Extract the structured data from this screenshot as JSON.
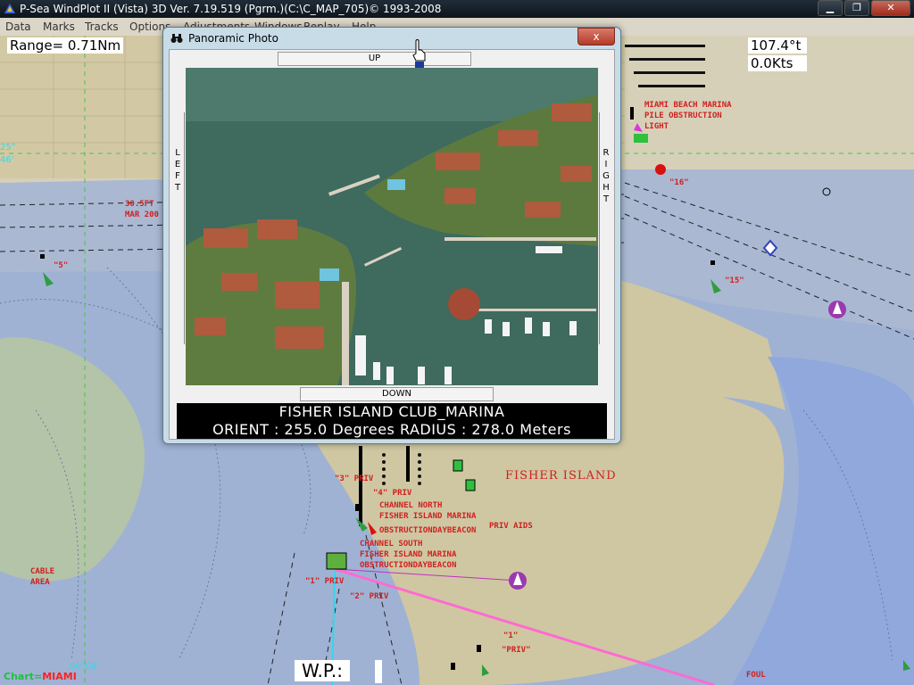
{
  "window": {
    "title": "P-Sea WindPlot II (Vista)  3D Ver. 7.19.519 (Pgrm.)(C:\\C_MAP_705)© 1993-2008",
    "minimize": "▁",
    "maximize": "❐",
    "close": "✕"
  },
  "menu": [
    "Data",
    "Marks",
    "Tracks",
    "Options",
    "Adjustments",
    "Windows",
    "Replay",
    "Help"
  ],
  "map": {
    "range_label": "Range=",
    "range_value": "0.71Nm",
    "heading": "107.4°t",
    "speed": "0.0Kts",
    "waypoint_label": "W.P.:",
    "chart_label": "Chart=",
    "chart_value": "MIAMI",
    "coord_top": "25°",
    "coord_top2": "46'",
    "coord_bottom": "80°08'",
    "labels": {
      "fisher_island": "FISHER ISLAND",
      "miami_beach_marina": "MIAMI BEACH MARINA",
      "pile_obstruction": "PILE OBSTRUCTION",
      "light": "LIGHT",
      "channel_north": "CHANNEL NORTH",
      "fisher_island_marina_1": "FISHER ISLAND MARINA",
      "obstruction_daybeacon_1": "OBSTRUCTIONDAYBEACON",
      "priv_aids": "PRIV AIDS",
      "channel_south": "CHANNEL SOUTH",
      "fisher_island_marina_2": "FISHER ISLAND MARINA",
      "obstruction_daybeacon_2": "OBSTRUCTIONDAYBEACON",
      "cable_area": "CABLE",
      "cable_area2": "AREA",
      "foul": "FOUL",
      "mark_3priv": "\"3\" PRIV",
      "mark_4priv": "\"4\" PRIV",
      "mark_1priv": "\"1\" PRIV",
      "mark_2priv": "\"2\" PRIV",
      "mark_1_priv_low": "\"1\"",
      "mark_1_priv_low2": "\"PRIV\"",
      "mark_5": "\"5\"",
      "mark_15": "\"15\"",
      "mark_16": "\"16\"",
      "depth_note": "30.5FT",
      "depth_note2": "MAR 200"
    }
  },
  "dialog": {
    "title": "Panoramic Photo",
    "close": "x",
    "up": "UP",
    "down": "DOWN",
    "left": "LEFT",
    "right": "RIGHT",
    "caption_line1": "FISHER ISLAND CLUB_MARINA",
    "caption_line2": "ORIENT : 255.0  Degrees  RADIUS : 278.0  Meters"
  }
}
